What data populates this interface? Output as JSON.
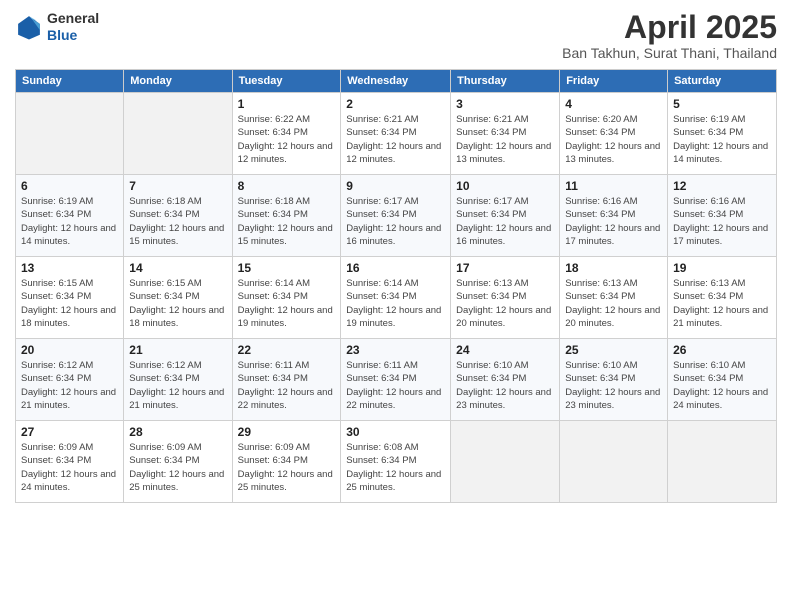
{
  "header": {
    "logo": {
      "general": "General",
      "blue": "Blue"
    },
    "title": "April 2025",
    "subtitle": "Ban Takhun, Surat Thani, Thailand"
  },
  "calendar": {
    "days_of_week": [
      "Sunday",
      "Monday",
      "Tuesday",
      "Wednesday",
      "Thursday",
      "Friday",
      "Saturday"
    ],
    "weeks": [
      [
        {
          "day": "",
          "sunrise": "",
          "sunset": "",
          "daylight": ""
        },
        {
          "day": "",
          "sunrise": "",
          "sunset": "",
          "daylight": ""
        },
        {
          "day": "1",
          "sunrise": "Sunrise: 6:22 AM",
          "sunset": "Sunset: 6:34 PM",
          "daylight": "Daylight: 12 hours and 12 minutes."
        },
        {
          "day": "2",
          "sunrise": "Sunrise: 6:21 AM",
          "sunset": "Sunset: 6:34 PM",
          "daylight": "Daylight: 12 hours and 12 minutes."
        },
        {
          "day": "3",
          "sunrise": "Sunrise: 6:21 AM",
          "sunset": "Sunset: 6:34 PM",
          "daylight": "Daylight: 12 hours and 13 minutes."
        },
        {
          "day": "4",
          "sunrise": "Sunrise: 6:20 AM",
          "sunset": "Sunset: 6:34 PM",
          "daylight": "Daylight: 12 hours and 13 minutes."
        },
        {
          "day": "5",
          "sunrise": "Sunrise: 6:19 AM",
          "sunset": "Sunset: 6:34 PM",
          "daylight": "Daylight: 12 hours and 14 minutes."
        }
      ],
      [
        {
          "day": "6",
          "sunrise": "Sunrise: 6:19 AM",
          "sunset": "Sunset: 6:34 PM",
          "daylight": "Daylight: 12 hours and 14 minutes."
        },
        {
          "day": "7",
          "sunrise": "Sunrise: 6:18 AM",
          "sunset": "Sunset: 6:34 PM",
          "daylight": "Daylight: 12 hours and 15 minutes."
        },
        {
          "day": "8",
          "sunrise": "Sunrise: 6:18 AM",
          "sunset": "Sunset: 6:34 PM",
          "daylight": "Daylight: 12 hours and 15 minutes."
        },
        {
          "day": "9",
          "sunrise": "Sunrise: 6:17 AM",
          "sunset": "Sunset: 6:34 PM",
          "daylight": "Daylight: 12 hours and 16 minutes."
        },
        {
          "day": "10",
          "sunrise": "Sunrise: 6:17 AM",
          "sunset": "Sunset: 6:34 PM",
          "daylight": "Daylight: 12 hours and 16 minutes."
        },
        {
          "day": "11",
          "sunrise": "Sunrise: 6:16 AM",
          "sunset": "Sunset: 6:34 PM",
          "daylight": "Daylight: 12 hours and 17 minutes."
        },
        {
          "day": "12",
          "sunrise": "Sunrise: 6:16 AM",
          "sunset": "Sunset: 6:34 PM",
          "daylight": "Daylight: 12 hours and 17 minutes."
        }
      ],
      [
        {
          "day": "13",
          "sunrise": "Sunrise: 6:15 AM",
          "sunset": "Sunset: 6:34 PM",
          "daylight": "Daylight: 12 hours and 18 minutes."
        },
        {
          "day": "14",
          "sunrise": "Sunrise: 6:15 AM",
          "sunset": "Sunset: 6:34 PM",
          "daylight": "Daylight: 12 hours and 18 minutes."
        },
        {
          "day": "15",
          "sunrise": "Sunrise: 6:14 AM",
          "sunset": "Sunset: 6:34 PM",
          "daylight": "Daylight: 12 hours and 19 minutes."
        },
        {
          "day": "16",
          "sunrise": "Sunrise: 6:14 AM",
          "sunset": "Sunset: 6:34 PM",
          "daylight": "Daylight: 12 hours and 19 minutes."
        },
        {
          "day": "17",
          "sunrise": "Sunrise: 6:13 AM",
          "sunset": "Sunset: 6:34 PM",
          "daylight": "Daylight: 12 hours and 20 minutes."
        },
        {
          "day": "18",
          "sunrise": "Sunrise: 6:13 AM",
          "sunset": "Sunset: 6:34 PM",
          "daylight": "Daylight: 12 hours and 20 minutes."
        },
        {
          "day": "19",
          "sunrise": "Sunrise: 6:13 AM",
          "sunset": "Sunset: 6:34 PM",
          "daylight": "Daylight: 12 hours and 21 minutes."
        }
      ],
      [
        {
          "day": "20",
          "sunrise": "Sunrise: 6:12 AM",
          "sunset": "Sunset: 6:34 PM",
          "daylight": "Daylight: 12 hours and 21 minutes."
        },
        {
          "day": "21",
          "sunrise": "Sunrise: 6:12 AM",
          "sunset": "Sunset: 6:34 PM",
          "daylight": "Daylight: 12 hours and 21 minutes."
        },
        {
          "day": "22",
          "sunrise": "Sunrise: 6:11 AM",
          "sunset": "Sunset: 6:34 PM",
          "daylight": "Daylight: 12 hours and 22 minutes."
        },
        {
          "day": "23",
          "sunrise": "Sunrise: 6:11 AM",
          "sunset": "Sunset: 6:34 PM",
          "daylight": "Daylight: 12 hours and 22 minutes."
        },
        {
          "day": "24",
          "sunrise": "Sunrise: 6:10 AM",
          "sunset": "Sunset: 6:34 PM",
          "daylight": "Daylight: 12 hours and 23 minutes."
        },
        {
          "day": "25",
          "sunrise": "Sunrise: 6:10 AM",
          "sunset": "Sunset: 6:34 PM",
          "daylight": "Daylight: 12 hours and 23 minutes."
        },
        {
          "day": "26",
          "sunrise": "Sunrise: 6:10 AM",
          "sunset": "Sunset: 6:34 PM",
          "daylight": "Daylight: 12 hours and 24 minutes."
        }
      ],
      [
        {
          "day": "27",
          "sunrise": "Sunrise: 6:09 AM",
          "sunset": "Sunset: 6:34 PM",
          "daylight": "Daylight: 12 hours and 24 minutes."
        },
        {
          "day": "28",
          "sunrise": "Sunrise: 6:09 AM",
          "sunset": "Sunset: 6:34 PM",
          "daylight": "Daylight: 12 hours and 25 minutes."
        },
        {
          "day": "29",
          "sunrise": "Sunrise: 6:09 AM",
          "sunset": "Sunset: 6:34 PM",
          "daylight": "Daylight: 12 hours and 25 minutes."
        },
        {
          "day": "30",
          "sunrise": "Sunrise: 6:08 AM",
          "sunset": "Sunset: 6:34 PM",
          "daylight": "Daylight: 12 hours and 25 minutes."
        },
        {
          "day": "",
          "sunrise": "",
          "sunset": "",
          "daylight": ""
        },
        {
          "day": "",
          "sunrise": "",
          "sunset": "",
          "daylight": ""
        },
        {
          "day": "",
          "sunrise": "",
          "sunset": "",
          "daylight": ""
        }
      ]
    ]
  }
}
